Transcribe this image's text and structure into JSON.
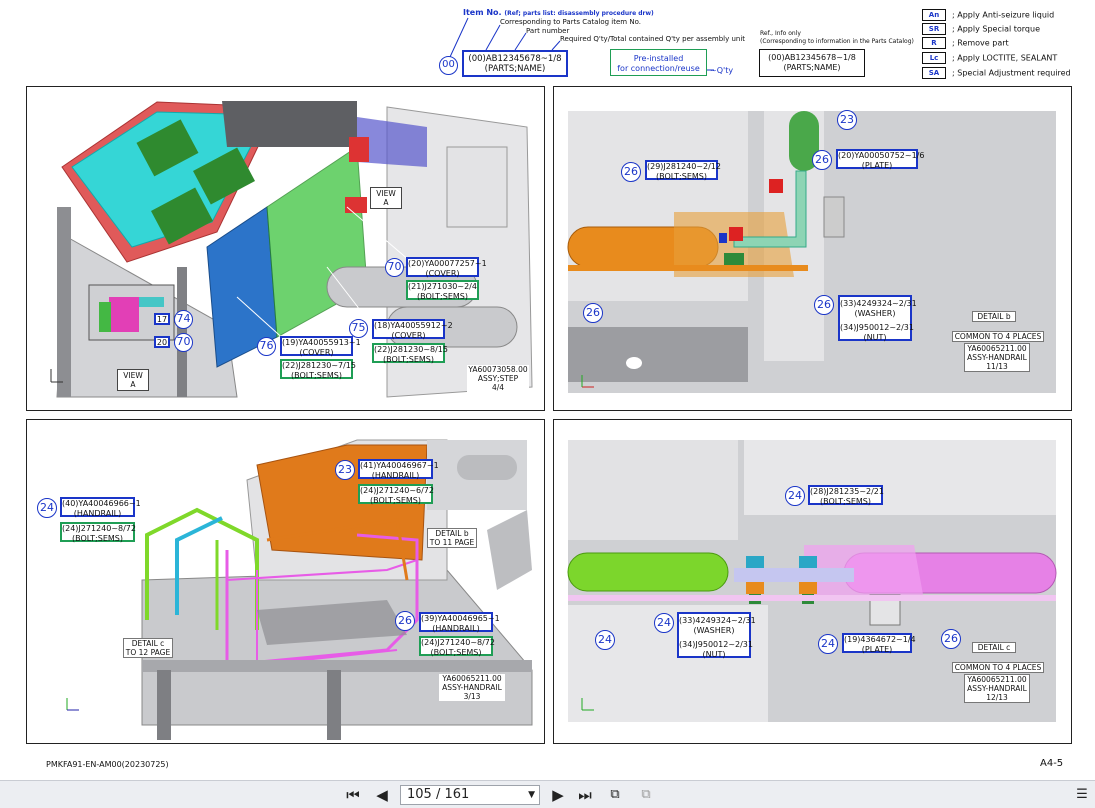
{
  "header": {
    "item_no_title": "Item No.",
    "item_no_note": "(Ref; parts list: disassembly procedure drw)",
    "corresponding": "Corresponding to Parts Catalog item No.",
    "part_number": "Part number",
    "required_qty": "Required Q'ty/Total contained Q'ty per assembly unit",
    "circle_label": "00",
    "sample_line1": "(00)AB12345678~1/8",
    "sample_line2": "(PARTS;NAME)",
    "preinstalled_line1": "Pre-installed",
    "preinstalled_line2": "for connection/reuse",
    "qty_label": "~Q'ty",
    "ref_info_line1": "Ref., Info only",
    "ref_info_line2": "(Corresponding to information in the Parts Catalog)",
    "ref_sample_line1": "(00)AB12345678~1/8",
    "ref_sample_line2": "(PARTS;NAME)"
  },
  "codes": [
    {
      "code": "An",
      "desc": "; Apply Anti-seizure liquid"
    },
    {
      "code": "SR",
      "desc": "; Apply Special torque"
    },
    {
      "code": "R",
      "desc": "; Remove part"
    },
    {
      "code": "Lc",
      "desc": "; Apply LOCTITE, SEALANT"
    },
    {
      "code": "SA",
      "desc": "; Special Adjustment required"
    }
  ],
  "panel1": {
    "view_a_top": "VIEW A",
    "view_a_bottom": "VIEW A",
    "c70": "70",
    "c75": "75",
    "c76": "76",
    "c74": "74",
    "c70b": "70",
    "b20_1": "(20)YA00077257~1",
    "b20_2": "(COVER)",
    "g21_1": "(21)J271030~2/4",
    "g21_2": "(BOLT;SEMS)",
    "b18_1": "(18)YA40055912~2",
    "b18_2": "(COVER)",
    "g22_1": "(22)J281230~8/15",
    "g22_2": "(BOLT;SEMS)",
    "b19_1": "(19)YA40055913~1",
    "b19_2": "(COVER)",
    "g22b_1": "(22)J281230~7/15",
    "g22b_2": "(BOLT;SEMS)",
    "s17": "17",
    "s20": "20",
    "assy_1": "YA60073058.00",
    "assy_2": "ASSY;STEP",
    "assy_3": "4/4"
  },
  "panel2": {
    "c23": "23",
    "c26a": "26",
    "c26b": "26",
    "c26c": "26",
    "c26d": "26",
    "b29_1": "(29)J281240~2/12",
    "b29_2": "(BOLT;SEMS)",
    "b20_1": "(20)YA00050752~1/6",
    "b20_2": "(PLATE)",
    "b33_1": "(33)4249324~2/31",
    "b33_2": "(WASHER)",
    "b34_1": "(34)J950012~2/31",
    "b34_2": "(NUT)",
    "detail": "DETAIL b",
    "common": "COMMON TO 4 PLACES",
    "assy_1": "YA60065211.00",
    "assy_2": "ASSY-HANDRAIL",
    "assy_3": "11/13"
  },
  "panel3": {
    "c24": "24",
    "c23": "23",
    "c26": "26",
    "b40_1": "(40)YA40046966~1",
    "b40_2": "(HANDRAIL)",
    "g24_1": "(24)J271240~8/72",
    "g24_2": "(BOLT;SEMS)",
    "b41_1": "(41)YA40046967~1",
    "b41_2": "(HANDRAIL)",
    "g24b_1": "(24)J271240~6/72",
    "g24b_2": "(BOLT;SEMS)",
    "b39_1": "(39)YA40046965~1",
    "b39_2": "(HANDRAIL)",
    "g24c_1": "(24)J271240~8/72",
    "g24c_2": "(BOLT;SEMS)",
    "detail_b_1": "DETAIL b",
    "detail_b_2": "TO 11 PAGE",
    "detail_c_1": "DETAIL c",
    "detail_c_2": "TO 12 PAGE",
    "assy_1": "YA60065211.00",
    "assy_2": "ASSY-HANDRAIL",
    "assy_3": "3/13"
  },
  "panel4": {
    "c24a": "24",
    "c24b": "24",
    "c24c": "24",
    "c24d": "24",
    "c26": "26",
    "b28_1": "(28)J281235~2/21",
    "b28_2": "(BOLT;SEMS)",
    "b33_1": "(33)4249324~2/31",
    "b33_2": "(WASHER)",
    "b34_1": "(34)J950012~2/31",
    "b34_2": "(NUT)",
    "b19_1": "(19)4364672~1/4",
    "b19_2": "(PLATE)",
    "detail": "DETAIL c",
    "common": "COMMON TO 4 PLACES",
    "assy_1": "YA60065211.00",
    "assy_2": "ASSY-HANDRAIL",
    "assy_3": "12/13"
  },
  "footer": {
    "doc_code": "PMKFA91-EN-AM00(20230725)",
    "page_label": "A4-5"
  },
  "viewer": {
    "page_display": "105 / 161"
  }
}
